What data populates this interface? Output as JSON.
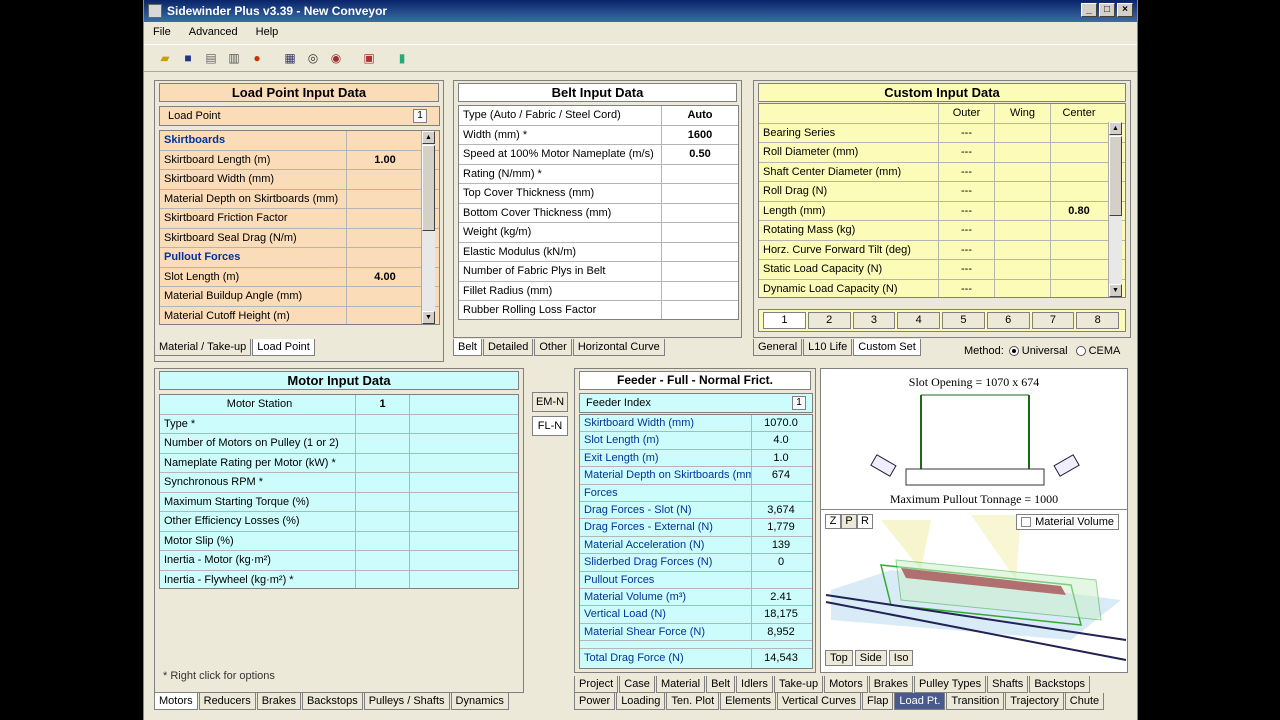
{
  "window": {
    "title": "Sidewinder Plus v3.39 - New Conveyor"
  },
  "menu": [
    "File",
    "Advanced",
    "Help"
  ],
  "load_point": {
    "title": "Load Point Input Data",
    "index_label": "Load Point",
    "index_value": "1",
    "rows": [
      {
        "label": "Skirtboards",
        "value": "",
        "header": true
      },
      {
        "label": "Skirtboard Length (m)",
        "value": "1.00"
      },
      {
        "label": "Skirtboard Width (mm)",
        "value": ""
      },
      {
        "label": "Material Depth on Skirtboards (mm)",
        "value": ""
      },
      {
        "label": "Skirtboard Friction Factor",
        "value": ""
      },
      {
        "label": "Skirtboard Seal Drag (N/m)",
        "value": ""
      },
      {
        "label": "Pullout Forces",
        "value": "",
        "header": true
      },
      {
        "label": "Slot Length (m)",
        "value": "4.00"
      },
      {
        "label": "Material Buildup Angle (mm)",
        "value": ""
      },
      {
        "label": "Material Cutoff Height (m)",
        "value": ""
      }
    ],
    "tabs": [
      "Material / Take-up",
      "Load Point"
    ]
  },
  "belt": {
    "title": "Belt Input Data",
    "rows": [
      {
        "label": "Type (Auto / Fabric / Steel Cord)",
        "value": "Auto"
      },
      {
        "label": "Width (mm) *",
        "value": "1600"
      },
      {
        "label": "Speed at 100% Motor Nameplate (m/s)",
        "value": "0.50"
      },
      {
        "label": "Rating (N/mm) *",
        "value": ""
      },
      {
        "label": "Top Cover Thickness (mm)",
        "value": ""
      },
      {
        "label": "Bottom Cover Thickness (mm)",
        "value": ""
      },
      {
        "label": "Weight (kg/m)",
        "value": ""
      },
      {
        "label": "Elastic Modulus (kN/m)",
        "value": ""
      },
      {
        "label": "Number of Fabric Plys in Belt",
        "value": ""
      },
      {
        "label": "Fillet Radius (mm)",
        "value": ""
      },
      {
        "label": "Rubber Rolling Loss Factor",
        "value": ""
      }
    ],
    "tabs": [
      "Belt",
      "Detailed",
      "Other",
      "Horizontal Curve"
    ]
  },
  "custom": {
    "title": "Custom Input Data",
    "columns": [
      "Outer",
      "Wing",
      "Center"
    ],
    "rows": [
      {
        "label": "Bearing Series",
        "outer": "---",
        "wing": "",
        "center": ""
      },
      {
        "label": "Roll Diameter (mm)",
        "outer": "---",
        "wing": "",
        "center": ""
      },
      {
        "label": "Shaft Center Diameter (mm)",
        "outer": "---",
        "wing": "",
        "center": ""
      },
      {
        "label": "Roll Drag (N)",
        "outer": "---",
        "wing": "",
        "center": ""
      },
      {
        "label": "Length (mm)",
        "outer": "---",
        "wing": "",
        "center": "0.80"
      },
      {
        "label": "Rotating Mass (kg)",
        "outer": "---",
        "wing": "",
        "center": ""
      },
      {
        "label": "Horz. Curve Forward Tilt (deg)",
        "outer": "---",
        "wing": "",
        "center": ""
      },
      {
        "label": "Static Load Capacity (N)",
        "outer": "---",
        "wing": "",
        "center": ""
      },
      {
        "label": "Dynamic Load Capacity (N)",
        "outer": "---",
        "wing": "",
        "center": ""
      }
    ],
    "sets": [
      "1",
      "2",
      "3",
      "4",
      "5",
      "6",
      "7",
      "8"
    ],
    "tabs": [
      "General",
      "L10 Life",
      "Custom Set"
    ],
    "method_label": "Method:",
    "method_options": [
      "Universal",
      "CEMA"
    ],
    "method_selected": "Universal"
  },
  "motor": {
    "title": "Motor Input Data",
    "station_label": "Motor Station",
    "station_value": "1",
    "rows": [
      {
        "label": "Type *",
        "value": ""
      },
      {
        "label": "Number of Motors on Pulley (1 or 2)",
        "value": ""
      },
      {
        "label": "Nameplate Rating per Motor (kW) *",
        "value": ""
      },
      {
        "label": "Synchronous RPM *",
        "value": ""
      },
      {
        "label": "Maximum Starting Torque (%)",
        "value": ""
      },
      {
        "label": "Other Efficiency Losses (%)",
        "value": ""
      },
      {
        "label": "Motor Slip (%)",
        "value": ""
      },
      {
        "label": "Inertia - Motor (kg·m²)",
        "value": ""
      },
      {
        "label": "Inertia - Flywheel (kg·m²) *",
        "value": ""
      }
    ],
    "note": "* Right click for options",
    "tabs": [
      "Motors",
      "Reducers",
      "Brakes",
      "Backstops",
      "Pulleys / Shafts",
      "Dynamics"
    ]
  },
  "side_buttons": [
    "EM-N",
    "FL-N"
  ],
  "feeder": {
    "title": "Feeder - Full - Normal Frict.",
    "index_label": "Feeder Index",
    "index_value": "1",
    "rows": [
      {
        "label": "Skirtboard Width (mm)",
        "value": "1070.0"
      },
      {
        "label": "Slot Length (m)",
        "value": "4.0"
      },
      {
        "label": "Exit Length (m)",
        "value": "1.0"
      },
      {
        "label": "Material Depth on Skirtboards (mm)",
        "value": "674"
      },
      {
        "label": "Forces",
        "value": "",
        "header": true
      },
      {
        "label": "Drag Forces - Slot (N)",
        "value": "3,674"
      },
      {
        "label": "Drag Forces - External (N)",
        "value": "1,779"
      },
      {
        "label": "Material Acceleration (N)",
        "value": "139"
      },
      {
        "label": "Sliderbed Drag Forces (N)",
        "value": "0"
      },
      {
        "label": "Pullout Forces",
        "value": "",
        "header": true
      },
      {
        "label": "Material Volume (m³)",
        "value": "2.41"
      },
      {
        "label": "Vertical Load (N)",
        "value": "18,175"
      },
      {
        "label": "Material Shear Force (N)",
        "value": "8,952"
      }
    ],
    "total_label": "Total Drag Force (N)",
    "total_value": "14,543"
  },
  "diagram": {
    "slot_opening": "Slot Opening = 1070 x 674",
    "max_pullout": "Maximum Pullout Tonnage = 1000",
    "axis_buttons": [
      "Z",
      "P",
      "R"
    ],
    "material_volume_label": "Material Volume",
    "view_buttons": [
      "Top",
      "Side",
      "Iso"
    ]
  },
  "bottom_tabs_row1": [
    "Project",
    "Case",
    "Material",
    "Belt",
    "Idlers",
    "Take-up",
    "Motors",
    "Brakes",
    "Pulley Types",
    "Shafts",
    "Backstops"
  ],
  "bottom_tabs_row2": [
    "Power",
    "Loading",
    "Ten. Plot",
    "Elements",
    "Vertical Curves",
    "Flap",
    "Load Pt.",
    "Transition",
    "Trajectory",
    "Chute"
  ],
  "bottom_tabs_active": "Load Pt."
}
